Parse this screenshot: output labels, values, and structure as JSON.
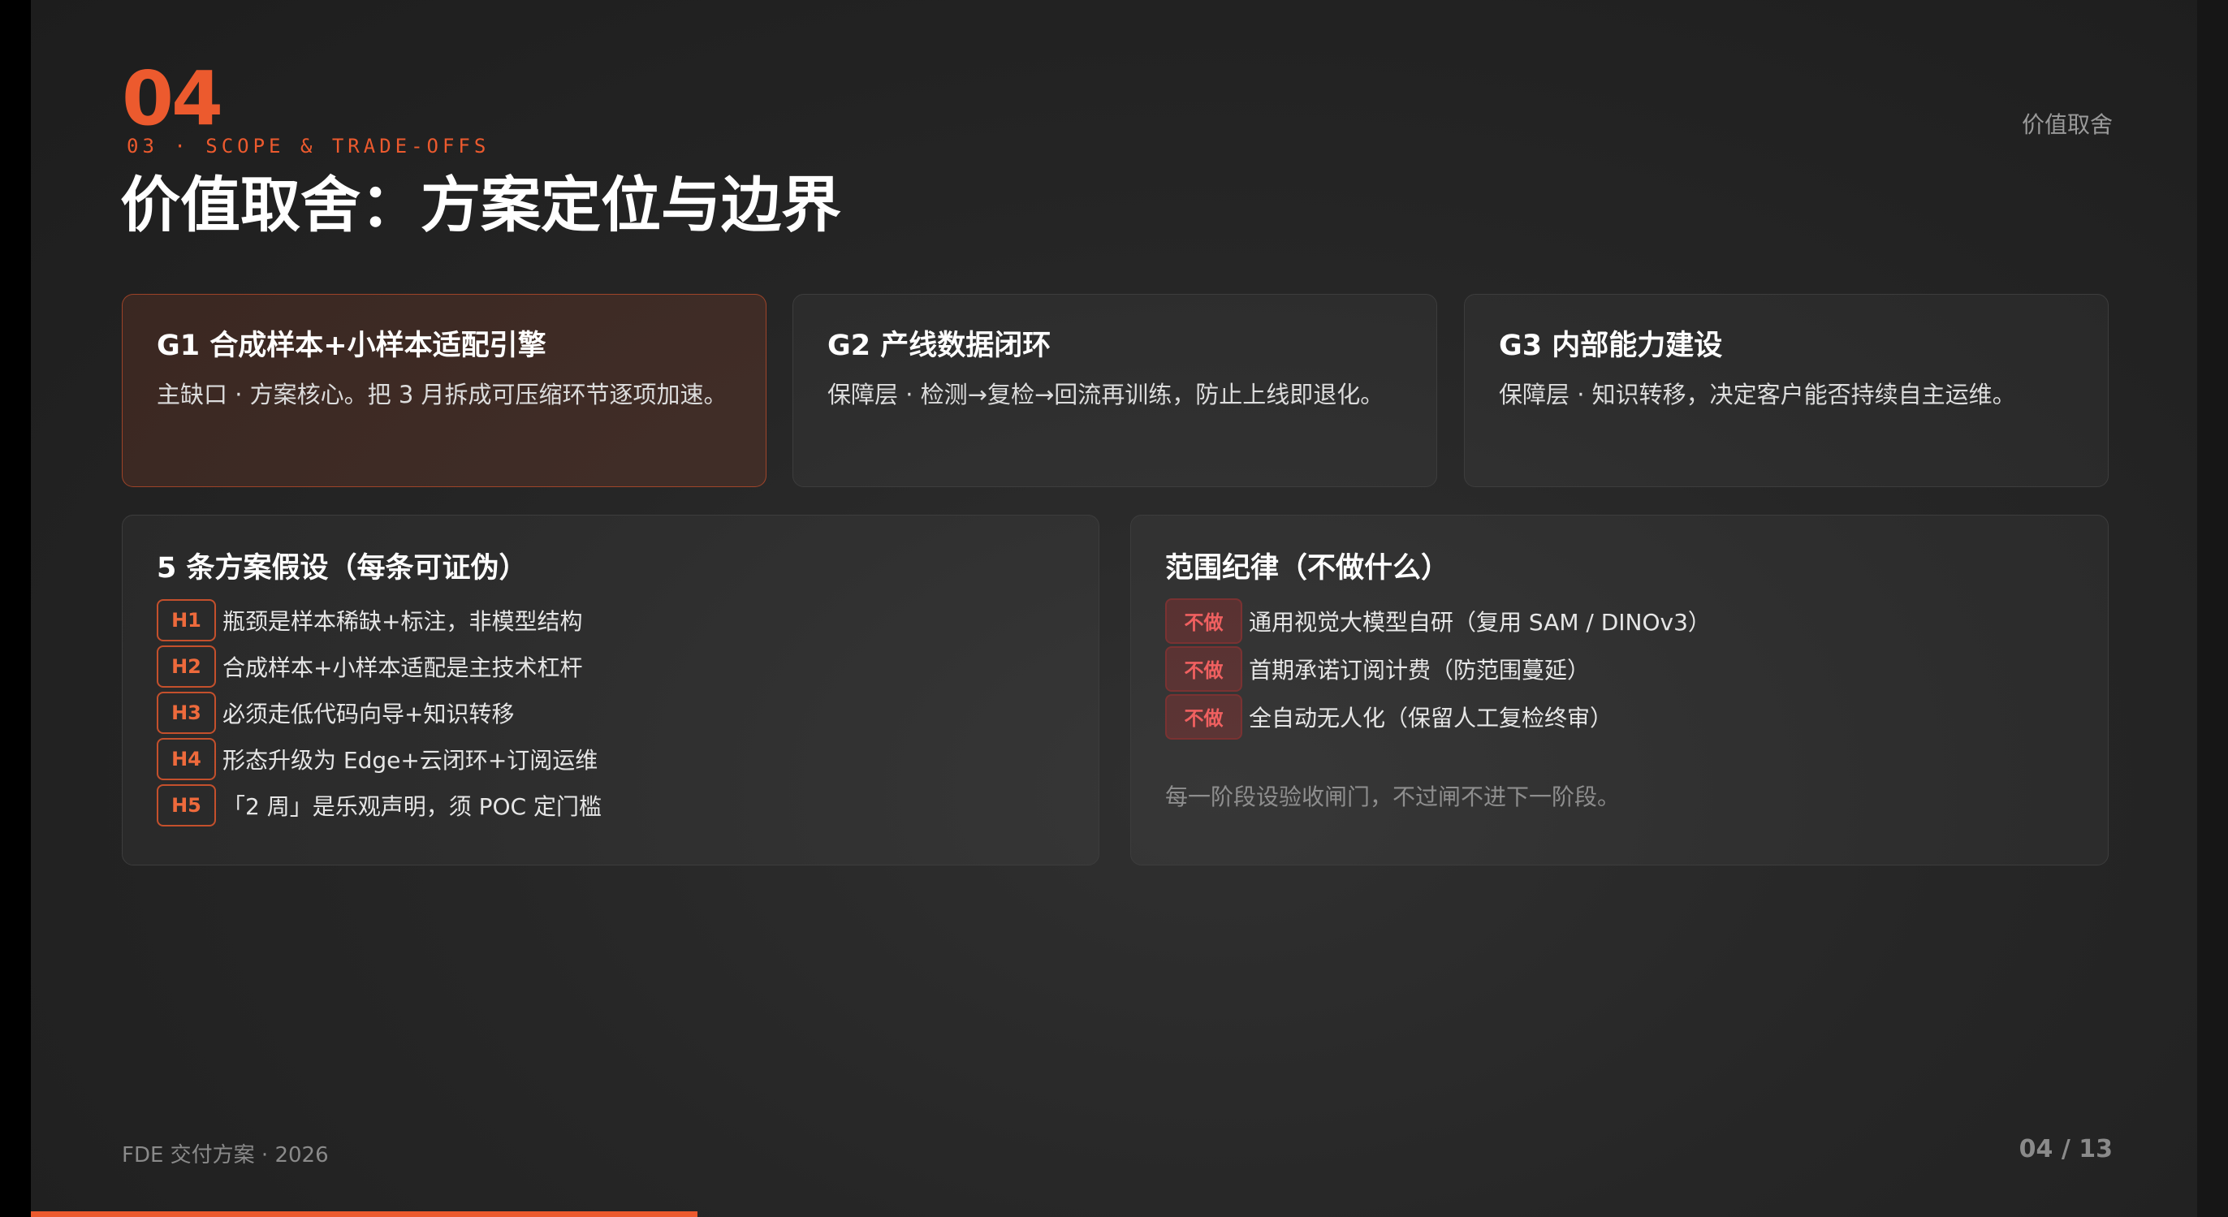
{
  "header": {
    "slide_number": "04",
    "section_label": "03 · SCOPE & TRADE-OFFS",
    "title": "价值取舍：方案定位与边界",
    "right_label": "价值取舍"
  },
  "goals": [
    {
      "title": "G1 合成样本+小样本适配引擎",
      "desc": "主缺口 · 方案核心。把 3 月拆成可压缩环节逐项加速。",
      "highlighted": true
    },
    {
      "title": "G2 产线数据闭环",
      "desc": "保障层 · 检测→复检→回流再训练，防止上线即退化。",
      "highlighted": false
    },
    {
      "title": "G3 内部能力建设",
      "desc": "保障层 · 知识转移，决定客户能否持续自主运维。",
      "highlighted": false
    }
  ],
  "hypotheses": {
    "title": "5 条方案假设（每条可证伪）",
    "items": [
      {
        "tag": "H1",
        "text": "瓶颈是样本稀缺+标注，非模型结构"
      },
      {
        "tag": "H2",
        "text": "合成样本+小样本适配是主技术杠杆"
      },
      {
        "tag": "H3",
        "text": "必须走低代码向导+知识转移"
      },
      {
        "tag": "H4",
        "text": "形态升级为 Edge+云闭环+订阅运维"
      },
      {
        "tag": "H5",
        "text": "「2 周」是乐观声明，须 POC 定门槛"
      }
    ]
  },
  "scope": {
    "title": "范围纪律（不做什么）",
    "badge_label": "不做",
    "items": [
      "通用视觉大模型自研（复用 SAM / DINOv3）",
      "首期承诺订阅计费（防范围蔓延）",
      "全自动无人化（保留人工复检终审）"
    ],
    "note": "每一阶段设验收闸门，不过闸不进下一阶段。"
  },
  "footer": {
    "left": "FDE 交付方案 · 2026",
    "page": "04 / 13",
    "progress_fraction": 0.3077
  },
  "colors": {
    "accent": "#ec5a2e",
    "background": "#262626",
    "no_badge": "#f06060"
  }
}
